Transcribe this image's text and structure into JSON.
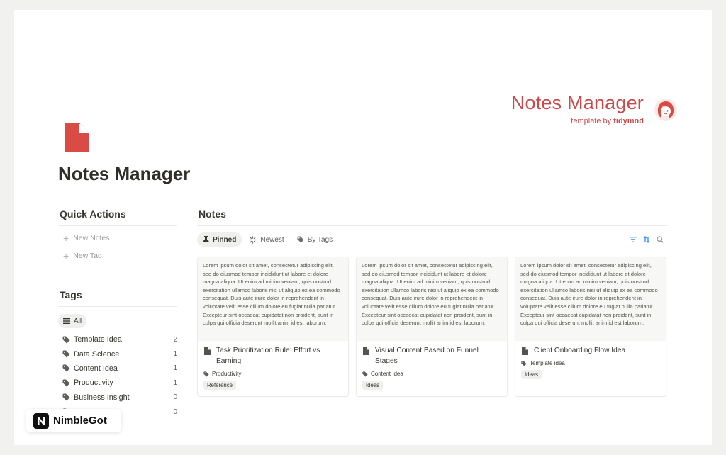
{
  "brand": {
    "title": "Notes Manager",
    "sub_prefix": "template by ",
    "sub_name": "tidymnd"
  },
  "page": {
    "title": "Notes Manager"
  },
  "quick_actions": {
    "heading": "Quick Actions",
    "items": [
      {
        "label": "New Notes"
      },
      {
        "label": "New Tag"
      }
    ]
  },
  "tags": {
    "heading": "Tags",
    "all_label": "All",
    "items": [
      {
        "name": "Template Idea",
        "count": "2"
      },
      {
        "name": "Data Science",
        "count": "1"
      },
      {
        "name": "Content Idea",
        "count": "1"
      },
      {
        "name": "Productivity",
        "count": "1"
      },
      {
        "name": "Business Insight",
        "count": "0"
      },
      {
        "name": "",
        "count": "0"
      }
    ]
  },
  "notes": {
    "heading": "Notes",
    "tabs": [
      {
        "label": "Pinned"
      },
      {
        "label": "Newest"
      },
      {
        "label": "By Tags"
      }
    ],
    "cards": [
      {
        "preview": "Lorem ipsum dolor sit amet, consectetur adipiscing elit, sed do eiusmod tempor incididunt ut labore et dolore magna aliqua. Ut enim ad minim veniam, quis nostrud exercitation ullamco laboris nisi ut aliquip ex ea commodo consequat. Duis aute irure dolor in reprehenderit in voluptate velit esse cillum dolore eu fugiat nulla pariatur. Excepteur sint occaecat cupidatat non proident, sunt in culpa qui officia deserunt mollit anim id est laborum.",
        "title": "Task Prioritization Rule: Effort vs Earning",
        "tag": "Productivity",
        "category": "Reference"
      },
      {
        "preview": "Lorem ipsum dolor sit amet, consectetur adipiscing elit, sed do eiusmod tempor incididunt ut labore et dolore magna aliqua. Ut enim ad minim veniam, quis nostrud exercitation ullamco laboris nisi ut aliquip ex ea commodo consequat. Duis aute irure dolor in reprehenderit in voluptate velit esse cillum dolore eu fugiat nulla pariatur. Excepteur sint occaecat cupidatat non proident, sunt in culpa qui officia deserunt mollit anim id est laborum.",
        "title": "Visual Content Based on Funnel Stages",
        "tag": "Content Idea",
        "category": "Ideas"
      },
      {
        "preview": "Lorem ipsum dolor sit amet, consectetur adipiscing elit, sed do eiusmod tempor incididunt ut labore et dolore magna aliqua. Ut enim ad minim veniam, quis nostrud exercitation ullamco laboris nisi ut aliquip ex ea commodo consequat. Duis aute irure dolor in reprehenderit in voluptate velit esse cillum dolore eu fugiat nulla pariatur. Excepteur sint occaecat cupidatat non proident, sunt in culpa qui officia deserunt mollit anim id est laborum.",
        "title": "Client Onboarding Flow Idea",
        "tag": "Template idea",
        "category": "Ideas"
      }
    ]
  },
  "watermark": {
    "label": "NimbleGot"
  },
  "colors": {
    "accent": "#c84b4b",
    "page_icon": "#d94c45"
  }
}
